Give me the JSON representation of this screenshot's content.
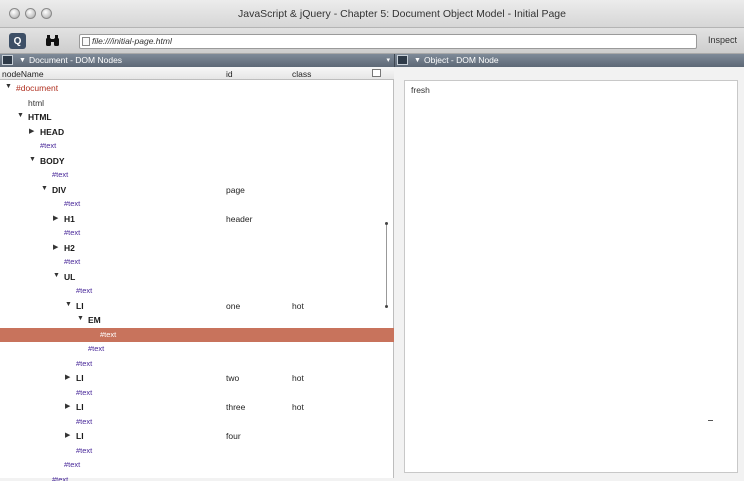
{
  "window": {
    "title": "JavaScript & jQuery - Chapter 5: Document Object Model - Initial Page"
  },
  "toolbar": {
    "dom_icon": "Q",
    "find_icon": "binoculars-icon",
    "url": "file:///initial-page.html",
    "inspect_label": "Inspect"
  },
  "left_pane": {
    "title": "Document - DOM Nodes",
    "columns": {
      "nodename": "nodeName",
      "id": "id",
      "class": "class"
    }
  },
  "right_pane": {
    "title": "Object - DOM Node",
    "value": "fresh"
  },
  "tree": [
    {
      "level": 0,
      "toggle": "▼",
      "name": "#document",
      "kind": "doc",
      "id": "",
      "class": ""
    },
    {
      "level": 1,
      "toggle": "",
      "name": "html",
      "kind": "plain",
      "id": "",
      "class": ""
    },
    {
      "level": 1,
      "toggle": "▼",
      "name": "HTML",
      "kind": "element",
      "id": "",
      "class": ""
    },
    {
      "level": 2,
      "toggle": "▶",
      "name": "HEAD",
      "kind": "element",
      "id": "",
      "class": ""
    },
    {
      "level": 2,
      "toggle": "",
      "name": "#text",
      "kind": "text",
      "id": "",
      "class": ""
    },
    {
      "level": 2,
      "toggle": "▼",
      "name": "BODY",
      "kind": "element",
      "id": "",
      "class": ""
    },
    {
      "level": 3,
      "toggle": "",
      "name": "#text",
      "kind": "text",
      "id": "",
      "class": ""
    },
    {
      "level": 3,
      "toggle": "▼",
      "name": "DIV",
      "kind": "element",
      "id": "page",
      "class": ""
    },
    {
      "level": 4,
      "toggle": "",
      "name": "#text",
      "kind": "text",
      "id": "",
      "class": ""
    },
    {
      "level": 4,
      "toggle": "▶",
      "name": "H1",
      "kind": "element",
      "id": "header",
      "class": ""
    },
    {
      "level": 4,
      "toggle": "",
      "name": "#text",
      "kind": "text",
      "id": "",
      "class": ""
    },
    {
      "level": 4,
      "toggle": "▶",
      "name": "H2",
      "kind": "element",
      "id": "",
      "class": ""
    },
    {
      "level": 4,
      "toggle": "",
      "name": "#text",
      "kind": "text",
      "id": "",
      "class": ""
    },
    {
      "level": 4,
      "toggle": "▼",
      "name": "UL",
      "kind": "element",
      "id": "",
      "class": ""
    },
    {
      "level": 5,
      "toggle": "",
      "name": "#text",
      "kind": "text",
      "id": "",
      "class": ""
    },
    {
      "level": 5,
      "toggle": "▼",
      "name": "LI",
      "kind": "element",
      "id": "one",
      "class": "hot"
    },
    {
      "level": 6,
      "toggle": "▼",
      "name": "EM",
      "kind": "element",
      "id": "",
      "class": ""
    },
    {
      "level": 7,
      "toggle": "",
      "name": "#text",
      "kind": "text",
      "id": "",
      "class": "",
      "selected": true
    },
    {
      "level": 6,
      "toggle": "",
      "name": "#text",
      "kind": "text",
      "id": "",
      "class": ""
    },
    {
      "level": 5,
      "toggle": "",
      "name": "#text",
      "kind": "text",
      "id": "",
      "class": ""
    },
    {
      "level": 5,
      "toggle": "▶",
      "name": "LI",
      "kind": "element",
      "id": "two",
      "class": "hot"
    },
    {
      "level": 5,
      "toggle": "",
      "name": "#text",
      "kind": "text",
      "id": "",
      "class": ""
    },
    {
      "level": 5,
      "toggle": "▶",
      "name": "LI",
      "kind": "element",
      "id": "three",
      "class": "hot"
    },
    {
      "level": 5,
      "toggle": "",
      "name": "#text",
      "kind": "text",
      "id": "",
      "class": ""
    },
    {
      "level": 5,
      "toggle": "▶",
      "name": "LI",
      "kind": "element",
      "id": "four",
      "class": ""
    },
    {
      "level": 5,
      "toggle": "",
      "name": "#text",
      "kind": "text",
      "id": "",
      "class": ""
    },
    {
      "level": 4,
      "toggle": "",
      "name": "#text",
      "kind": "text",
      "id": "",
      "class": ""
    },
    {
      "level": 3,
      "toggle": "",
      "name": "#text",
      "kind": "text",
      "id": "",
      "class": ""
    }
  ],
  "colors": {
    "selected_row": "#c8735c",
    "text_node": "#4a2a9a",
    "document_node": "#b03020"
  }
}
